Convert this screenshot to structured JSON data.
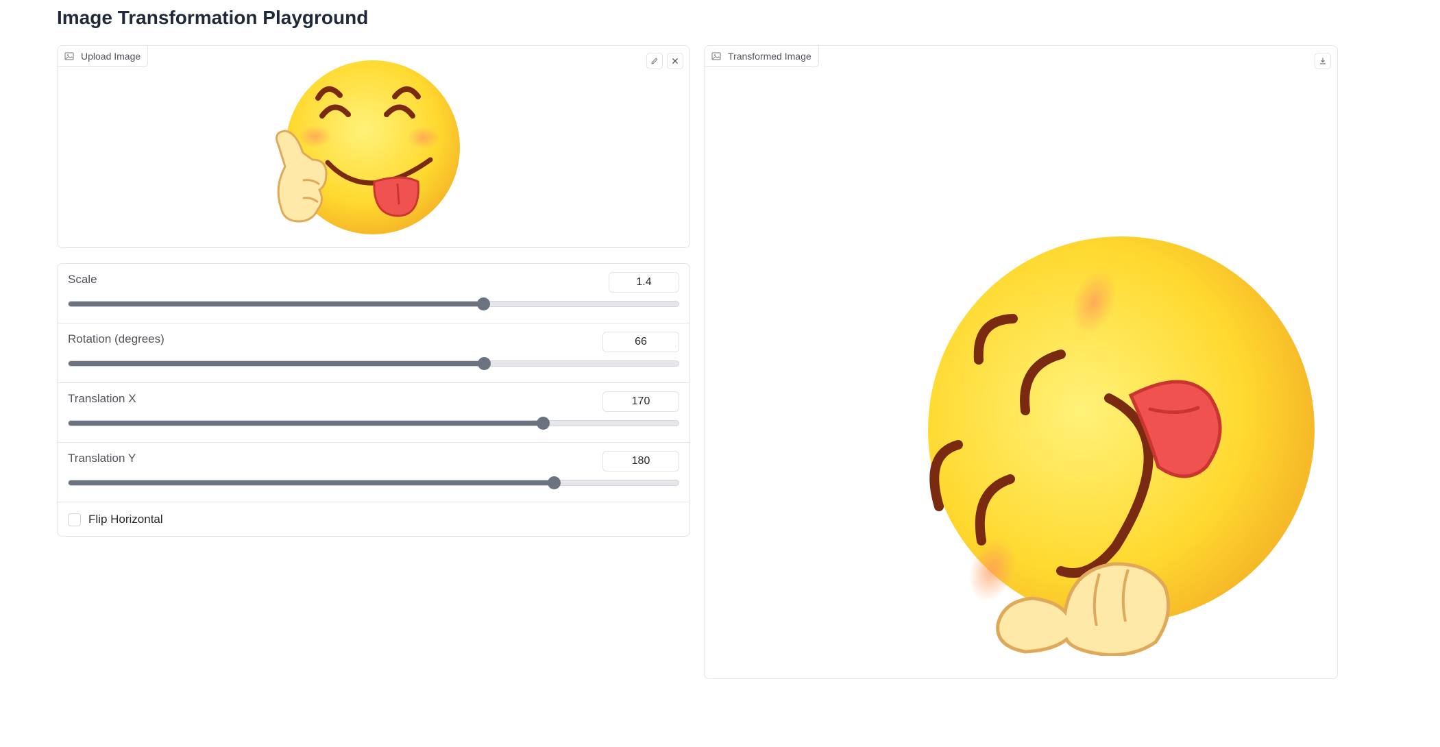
{
  "page": {
    "title": "Image Transformation Playground"
  },
  "upload": {
    "label": "Upload Image",
    "label_icon": "image-icon",
    "edit_icon": "pencil-icon",
    "clear_icon": "close-icon"
  },
  "output": {
    "label": "Transformed Image",
    "label_icon": "image-icon",
    "download_icon": "download-icon"
  },
  "controls": {
    "scale": {
      "label": "Scale",
      "value": "1.4",
      "fraction": 0.68
    },
    "rotation": {
      "label": "Rotation (degrees)",
      "value": "66",
      "fraction": 0.681
    },
    "translation_x": {
      "label": "Translation X",
      "value": "170",
      "fraction": 0.778
    },
    "translation_y": {
      "label": "Translation Y",
      "value": "180",
      "fraction": 0.796
    },
    "flip": {
      "label": "Flip Horizontal",
      "checked": false
    }
  },
  "colors": {
    "slider_fill": "#6b7280",
    "slider_track": "#e5e7eb",
    "emoji_face": "#ffd93b",
    "emoji_tongue": "#f0534f"
  }
}
